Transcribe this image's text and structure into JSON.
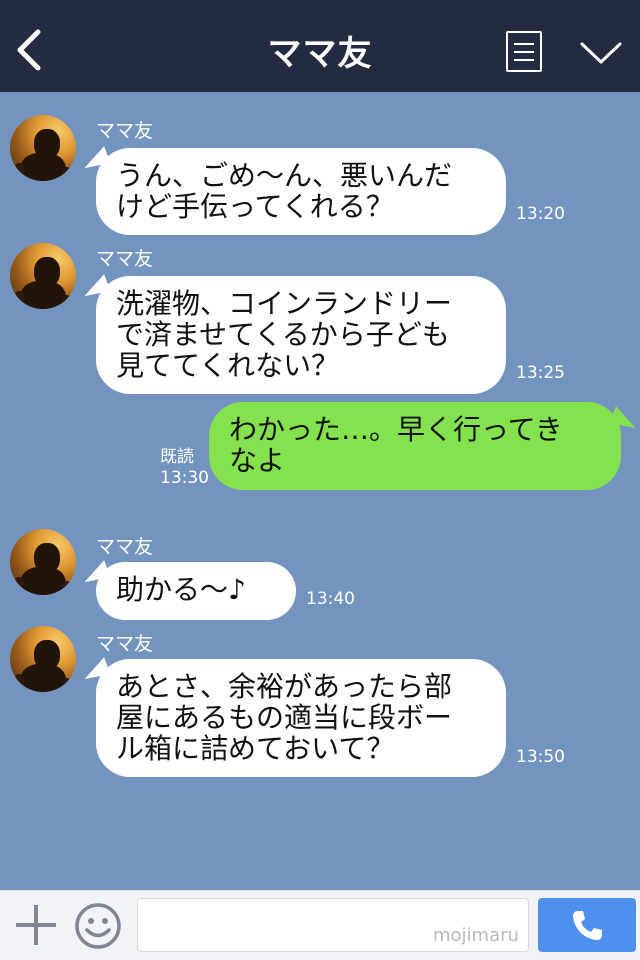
{
  "header": {
    "title": "ママ友",
    "back_icon": "chevron-left-icon",
    "menu_icon": "list-icon",
    "collapse_icon": "chevron-down-icon"
  },
  "messages": [
    {
      "sender": "ママ友",
      "text": "うん、ごめ〜ん、悪いんだ\nけど手伝ってくれる？",
      "time": "13:20"
    },
    {
      "sender": "ママ友",
      "text": "洗濯物、コインランドリー\nで済ませてくるから子ども\n見ててくれない？",
      "time": "13:25"
    },
    {
      "sender": "me",
      "text": "わかった…。早く行ってき\nなよ",
      "read_label": "既読",
      "time": "13:30"
    },
    {
      "sender": "ママ友",
      "text": "助かる〜♪",
      "time": "13:40"
    },
    {
      "sender": "ママ友",
      "text": "あとさ、余裕があったら部\n屋にあるもの適当に段ボー\nル箱に詰めておいて？",
      "time": "13:50"
    }
  ],
  "footer": {
    "input_value": "",
    "watermark": "mojimaru",
    "plus_icon": "plus-icon",
    "emoji_icon": "smiley-icon",
    "call_icon": "phone-icon"
  },
  "colors": {
    "header_bg": "#232b43",
    "chat_bg": "#7494c0",
    "incoming_bubble": "#ffffff",
    "outgoing_bubble": "#84e24f",
    "call_button": "#4f8ff0"
  }
}
